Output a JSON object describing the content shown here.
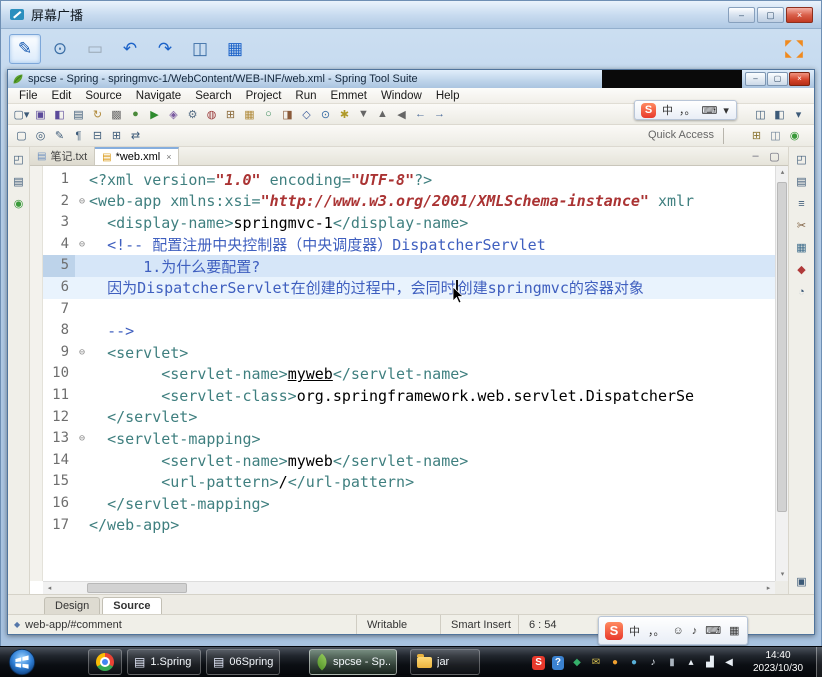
{
  "broadcast": {
    "title": "屏幕广播",
    "window_buttons": [
      {
        "name": "broadcast-minimize-button",
        "glyph": "–"
      },
      {
        "name": "broadcast-maximize-button",
        "glyph": "▢"
      },
      {
        "name": "broadcast-close-button",
        "glyph": "×"
      }
    ],
    "tools": [
      {
        "name": "pen-tool-icon",
        "glyph": "✎",
        "sel": true,
        "color": "#1558b0"
      },
      {
        "name": "zoom-tool-icon",
        "glyph": "⊙",
        "color": "#3b6ea5"
      },
      {
        "name": "screenshot-tool-icon",
        "glyph": "▭",
        "dis": true
      },
      {
        "name": "undo-icon",
        "glyph": "↶",
        "color": "#1b62c8"
      },
      {
        "name": "redo-icon",
        "glyph": "↷",
        "color": "#1b62c8"
      },
      {
        "name": "monitor-tool-icon",
        "glyph": "◫",
        "color": "#3b6ea5"
      },
      {
        "name": "share-screen-icon",
        "glyph": "▦",
        "color": "#1b62c8"
      }
    ]
  },
  "eclipse": {
    "title": "spcse - Spring - springmvc-1/WebContent/WEB-INF/web.xml - Spring Tool Suite",
    "window_buttons": [
      {
        "name": "eclipse-minimize-button",
        "glyph": "–"
      },
      {
        "name": "eclipse-maximize-button",
        "glyph": "▢"
      },
      {
        "name": "eclipse-close-button",
        "glyph": "×"
      }
    ],
    "menus": [
      "File",
      "Edit",
      "Source",
      "Navigate",
      "Search",
      "Project",
      "Run",
      "Emmet",
      "Window",
      "Help"
    ],
    "toolbar_main": [
      {
        "name": "new-wizard-icon",
        "glyph": "▢▾"
      },
      {
        "name": "save-icon",
        "glyph": "▣",
        "color": "#5b4a9a"
      },
      {
        "name": "save-all-icon",
        "glyph": "◧",
        "color": "#5b4a9a"
      },
      {
        "name": "print-icon",
        "glyph": "▤"
      },
      {
        "name": "refresh-icon",
        "glyph": "↻",
        "color": "#b08a3a"
      },
      {
        "name": "build-all-icon",
        "glyph": "▩",
        "color": "#6a6a6a"
      },
      {
        "name": "debug-icon",
        "glyph": "●",
        "color": "#4a8a3a"
      },
      {
        "name": "run-icon",
        "glyph": "▶",
        "color": "#2e8b2e"
      },
      {
        "name": "profile-icon",
        "glyph": "◈",
        "color": "#7a5aa0"
      },
      {
        "name": "external-tools-icon",
        "glyph": "⚙",
        "color": "#566d84"
      },
      {
        "name": "coverage-icon",
        "glyph": "◍",
        "color": "#9a3a3a"
      },
      {
        "name": "new-java-project-icon",
        "glyph": "⊞",
        "color": "#8a6a3a"
      },
      {
        "name": "new-package-icon",
        "glyph": "▦",
        "color": "#b08a3a"
      },
      {
        "name": "new-class-icon",
        "glyph": "○",
        "color": "#3a8a5a"
      },
      {
        "name": "jar-export-icon",
        "glyph": "◨",
        "color": "#8a5a3a"
      },
      {
        "name": "javadoc-icon",
        "glyph": "◇",
        "color": "#3a5a9a"
      },
      {
        "name": "search-icon",
        "glyph": "⊙",
        "color": "#3b6ea5"
      },
      {
        "name": "mark-occurrences-icon",
        "glyph": "✱",
        "color": "#b09a2a"
      },
      {
        "name": "next-annotation-icon",
        "glyph": "▼",
        "color": "#666666"
      },
      {
        "name": "prev-annotation-icon",
        "glyph": "▲",
        "color": "#666666"
      },
      {
        "name": "last-edit-location-icon",
        "glyph": "◀",
        "color": "#666666"
      },
      {
        "name": "back-icon",
        "glyph": "←",
        "color": "#4a6a9a"
      },
      {
        "name": "forward-icon",
        "glyph": "→",
        "color": "#4a6a9a"
      }
    ],
    "toolbar_secondary": [
      {
        "name": "new-file-icon",
        "glyph": "▢"
      },
      {
        "name": "open-task-icon",
        "glyph": "◎"
      },
      {
        "name": "pin-editor-icon",
        "glyph": "✎"
      },
      {
        "name": "show-whitespace-icon",
        "glyph": "¶"
      },
      {
        "name": "collapse-all-icon",
        "glyph": "⊟"
      },
      {
        "name": "expand-all-icon",
        "glyph": "⊞"
      },
      {
        "name": "link-with-editor-icon",
        "glyph": "⇄"
      }
    ],
    "toolbar_right": [
      {
        "name": "editor-list-icon",
        "glyph": "◫"
      },
      {
        "name": "detach-icon",
        "glyph": "◧"
      },
      {
        "name": "toolbar-more-icon",
        "glyph": "▾"
      }
    ],
    "quick_access": "Quick Access",
    "perspective_icons": [
      {
        "name": "open-perspective-icon",
        "glyph": "⊞",
        "color": "#8a7430"
      },
      {
        "name": "java-ee-perspective-icon",
        "glyph": "◫",
        "color": "#6b7f95"
      },
      {
        "name": "spring-perspective-icon",
        "glyph": "◉",
        "color": "#3a9a3a"
      }
    ],
    "left_rail": [
      {
        "name": "restore-view-icon",
        "glyph": "◰"
      },
      {
        "name": "package-explorer-icon",
        "glyph": "▤"
      },
      {
        "name": "spring-explorer-icon",
        "glyph": "◉",
        "color": "#3a9a3a"
      }
    ],
    "right_rail": [
      {
        "name": "restore-view-icon",
        "glyph": "◰"
      },
      {
        "name": "task-list-icon",
        "glyph": "▤"
      },
      {
        "name": "outline-icon",
        "glyph": "≡"
      },
      {
        "name": "snippets-icon",
        "glyph": "✂",
        "color": "#7a5a3a"
      },
      {
        "name": "servers-icon",
        "glyph": "▦",
        "color": "#3a6a8a"
      },
      {
        "name": "error-log-icon",
        "glyph": "◆",
        "color": "#b03a3a"
      },
      {
        "name": "history-icon",
        "glyph": "◔"
      },
      {
        "spacer": true
      },
      {
        "name": "console-icon",
        "glyph": "▣"
      }
    ],
    "tabs": [
      {
        "label": "笔记.txt",
        "icon": "text-file-icon",
        "icon_glyph": "▤",
        "icon_color": "#6b8fc0"
      },
      {
        "label": "*web.xml",
        "active": true,
        "icon": "xml-file-icon",
        "icon_glyph": "▤",
        "icon_color": "#d8960f",
        "close_glyph": "×"
      }
    ],
    "editor_controls": [
      {
        "name": "minimize-editor-icon",
        "glyph": "–"
      },
      {
        "name": "maximize-editor-icon",
        "glyph": "▢"
      }
    ],
    "bottom_tabs": [
      {
        "label": "Design"
      },
      {
        "label": "Source",
        "active": true
      }
    ],
    "status": {
      "context": "web-app/#comment",
      "writable": "Writable",
      "insert_mode": "Smart Insert",
      "position": "6 : 54"
    }
  },
  "editor": {
    "lines": [
      {
        "n": 1,
        "segs": [
          {
            "t": "<?xml ",
            "c": "tag"
          },
          {
            "t": "version=",
            "c": "attr"
          },
          {
            "t": "\"1.0\"",
            "c": "val"
          },
          {
            "t": " ",
            "c": "plain"
          },
          {
            "t": "encoding=",
            "c": "attr"
          },
          {
            "t": "\"UTF-8\"",
            "c": "val"
          },
          {
            "t": "?>",
            "c": "tag"
          }
        ]
      },
      {
        "n": 2,
        "fold": true,
        "segs": [
          {
            "t": "<web-app ",
            "c": "tag"
          },
          {
            "t": "xmlns:xsi=",
            "c": "attr"
          },
          {
            "t": "\"http://www.w3.org/2001/XMLSchema-instance\"",
            "c": "val"
          },
          {
            "t": " ",
            "c": "plain"
          },
          {
            "t": "xmlr",
            "c": "attr"
          }
        ]
      },
      {
        "n": 3,
        "segs": [
          {
            "t": "  ",
            "c": "plain"
          },
          {
            "t": "<display-name>",
            "c": "tag"
          },
          {
            "t": "springmvc-1",
            "c": "text"
          },
          {
            "t": "</display-name>",
            "c": "tag"
          }
        ]
      },
      {
        "n": 4,
        "fold": true,
        "segs": [
          {
            "t": "  ",
            "c": "plain"
          },
          {
            "t": "<!-- 配置注册中央控制器（中央调度器）DispatcherServlet",
            "c": "comment"
          }
        ]
      },
      {
        "n": 5,
        "hl": "strong",
        "segs": [
          {
            "t": "      ",
            "c": "plain"
          },
          {
            "t": "1.为什么要配置?",
            "c": "comment"
          }
        ]
      },
      {
        "n": 6,
        "hl": "soft",
        "segs": [
          {
            "t": "  ",
            "c": "plain"
          },
          {
            "t": "因为DispatcherServlet在创建的过程中，会同时",
            "c": "comment"
          },
          {
            "t": "",
            "c": "caret"
          },
          {
            "t": "创建springmvc的容器对象",
            "c": "comment"
          }
        ]
      },
      {
        "n": 7,
        "segs": []
      },
      {
        "n": 8,
        "segs": [
          {
            "t": "  ",
            "c": "plain"
          },
          {
            "t": "-->",
            "c": "comment"
          }
        ]
      },
      {
        "n": 9,
        "fold": true,
        "segs": [
          {
            "t": "  ",
            "c": "plain"
          },
          {
            "t": "<servlet>",
            "c": "tag"
          }
        ]
      },
      {
        "n": 10,
        "segs": [
          {
            "t": "        ",
            "c": "plain"
          },
          {
            "t": "<servlet-name>",
            "c": "tag"
          },
          {
            "t": "myweb",
            "c": "text",
            "u": true
          },
          {
            "t": "</servlet-name>",
            "c": "tag"
          }
        ]
      },
      {
        "n": 11,
        "segs": [
          {
            "t": "        ",
            "c": "plain"
          },
          {
            "t": "<servlet-class>",
            "c": "tag"
          },
          {
            "t": "org.springframework.web.servlet.DispatcherSe",
            "c": "text"
          }
        ]
      },
      {
        "n": 12,
        "segs": [
          {
            "t": "  ",
            "c": "plain"
          },
          {
            "t": "</servlet>",
            "c": "tag"
          }
        ]
      },
      {
        "n": 13,
        "fold": true,
        "segs": [
          {
            "t": "  ",
            "c": "plain"
          },
          {
            "t": "<servlet-mapping>",
            "c": "tag"
          }
        ]
      },
      {
        "n": 14,
        "segs": [
          {
            "t": "        ",
            "c": "plain"
          },
          {
            "t": "<servlet-name>",
            "c": "tag"
          },
          {
            "t": "myweb",
            "c": "text"
          },
          {
            "t": "</servlet-name>",
            "c": "tag"
          }
        ]
      },
      {
        "n": 15,
        "segs": [
          {
            "t": "        ",
            "c": "plain"
          },
          {
            "t": "<url-pattern>",
            "c": "tag"
          },
          {
            "t": "/",
            "c": "text"
          },
          {
            "t": "</url-pattern>",
            "c": "tag"
          }
        ]
      },
      {
        "n": 16,
        "segs": [
          {
            "t": "  ",
            "c": "plain"
          },
          {
            "t": "</servlet-mapping>",
            "c": "tag"
          }
        ]
      },
      {
        "n": 17,
        "segs": [
          {
            "t": "</web-app>",
            "c": "tag"
          }
        ]
      }
    ]
  },
  "ime": {
    "logo": "S",
    "top_icons": [
      {
        "name": "ime-mode-icon",
        "glyph": "中"
      },
      {
        "name": "ime-punct-icon",
        "glyph": "，。"
      },
      {
        "name": "ime-keyboard-icon",
        "glyph": "⌨"
      },
      {
        "name": "ime-more-icon",
        "glyph": "▾"
      }
    ],
    "bottom_icons": [
      {
        "name": "ime-mode-icon",
        "glyph": "中"
      },
      {
        "name": "ime-punct-icon",
        "glyph": "，。"
      },
      {
        "name": "ime-emoji-icon",
        "glyph": "☺"
      },
      {
        "name": "ime-mic-icon",
        "glyph": "♪"
      },
      {
        "name": "ime-keyboard-icon",
        "glyph": "⌨"
      },
      {
        "name": "ime-toolbox-icon",
        "glyph": "▦"
      }
    ]
  },
  "taskbar": {
    "items": [
      {
        "icon": "chrome",
        "label": ""
      },
      {
        "icon": "doc",
        "label": "1.Spring ..."
      },
      {
        "icon": "doc",
        "label": "06Spring..."
      },
      {
        "icon": "spring",
        "label": "spcse - Sp...",
        "active": true
      },
      {
        "icon": "folder",
        "label": "jar"
      }
    ],
    "tray": [
      {
        "name": "sogou-tray-icon",
        "glyph": "S",
        "bg": "#e8392c",
        "color": "#ffffff"
      },
      {
        "name": "helper-tray-icon",
        "glyph": "?",
        "bg": "#3b82d0",
        "color": "#ffffff"
      },
      {
        "name": "security-tray-icon",
        "glyph": "◆",
        "color": "#35b06a"
      },
      {
        "name": "message-tray-icon",
        "glyph": "✉",
        "color": "#d8c050"
      },
      {
        "name": "chat-tray-icon",
        "glyph": "●",
        "color": "#f0a030"
      },
      {
        "name": "cloud-tray-icon",
        "glyph": "●",
        "color": "#58b0d8"
      },
      {
        "name": "music-tray-icon",
        "glyph": "♪",
        "color": "#dfe6ee"
      },
      {
        "name": "usb-tray-icon",
        "glyph": "▮",
        "color": "#aab4be"
      },
      {
        "name": "hidden-icons-tray-icon",
        "glyph": "▴",
        "color": "#e8eef4"
      },
      {
        "name": "network-tray-icon",
        "glyph": "▟",
        "color": "#e8eef4"
      },
      {
        "name": "volume-tray-icon",
        "glyph": "◀",
        "color": "#e8eef4"
      }
    ],
    "clock": {
      "time": "14:40",
      "date": "2023/10/30"
    }
  }
}
